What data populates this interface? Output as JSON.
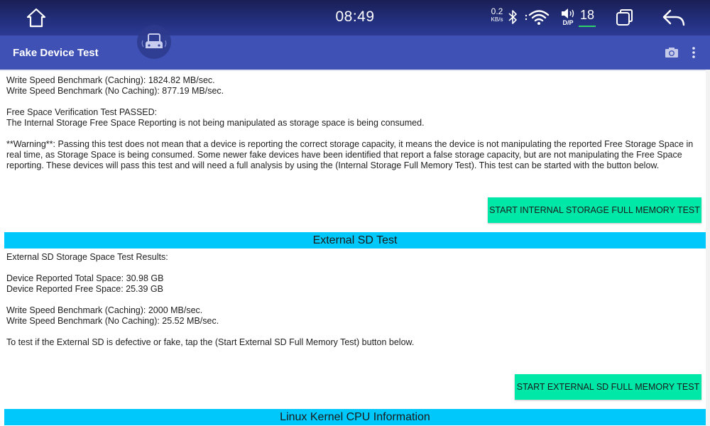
{
  "statusbar": {
    "time": "08:49",
    "net_speed_value": "0.2",
    "net_speed_unit": "KB/s",
    "audio_mode": "D/P",
    "volume_level": "18",
    "icons": [
      "home-icon",
      "bluetooth-icon",
      "wifi-icon",
      "volume-icon",
      "recent-apps-icon",
      "back-icon"
    ]
  },
  "appbar": {
    "title": "Fake Device Test",
    "actions": [
      "camera-icon",
      "overflow-menu-icon"
    ]
  },
  "internal": {
    "write_caching": "Write Speed Benchmark (Caching): 1824.82 MB/sec.",
    "write_no_caching": "Write Speed Benchmark (No Caching): 877.19 MB/sec.",
    "free_space_passed": "Free Space Verification Test PASSED:",
    "free_space_detail": "The Internal Storage Free Space Reporting is not being manipulated as storage space is being consumed.",
    "warning": "**Warning**: Passing this test does not mean that a device is reporting the correct storage capacity, it means the device is not manipulating the reported Free Storage Space in real time, as Storage Space is being consumed. Some newer fake devices have been identified that report a false storage capacity, but are not manipulating the Free Space reporting. These devices will pass this test and will need a full analysis by using the (Internal Storage Full Memory Test). This test can be started with the button below.",
    "button_label": "START INTERNAL STORAGE FULL MEMORY TEST"
  },
  "external": {
    "header": "External SD Test",
    "results_title": "External SD Storage Space Test Results:",
    "total_space": "Device Reported Total Space: 30.98 GB",
    "free_space": "Device Reported Free Space: 25.39 GB",
    "write_caching": "Write Speed Benchmark (Caching): 2000 MB/sec.",
    "write_no_caching": "Write Speed Benchmark (No Caching): 25.52 MB/sec.",
    "instruction": "To test if the External SD is defective or fake, tap the (Start External SD Full Memory Test) button below.",
    "button_label": "START EXTERNAL SD FULL MEMORY TEST"
  },
  "cpu": {
    "header": "Linux Kernel CPU Information"
  },
  "colors": {
    "statusbar": "#23307e",
    "appbar": "#3f51b5",
    "button": "#00e8a8",
    "section_header": "#00c8fa"
  }
}
